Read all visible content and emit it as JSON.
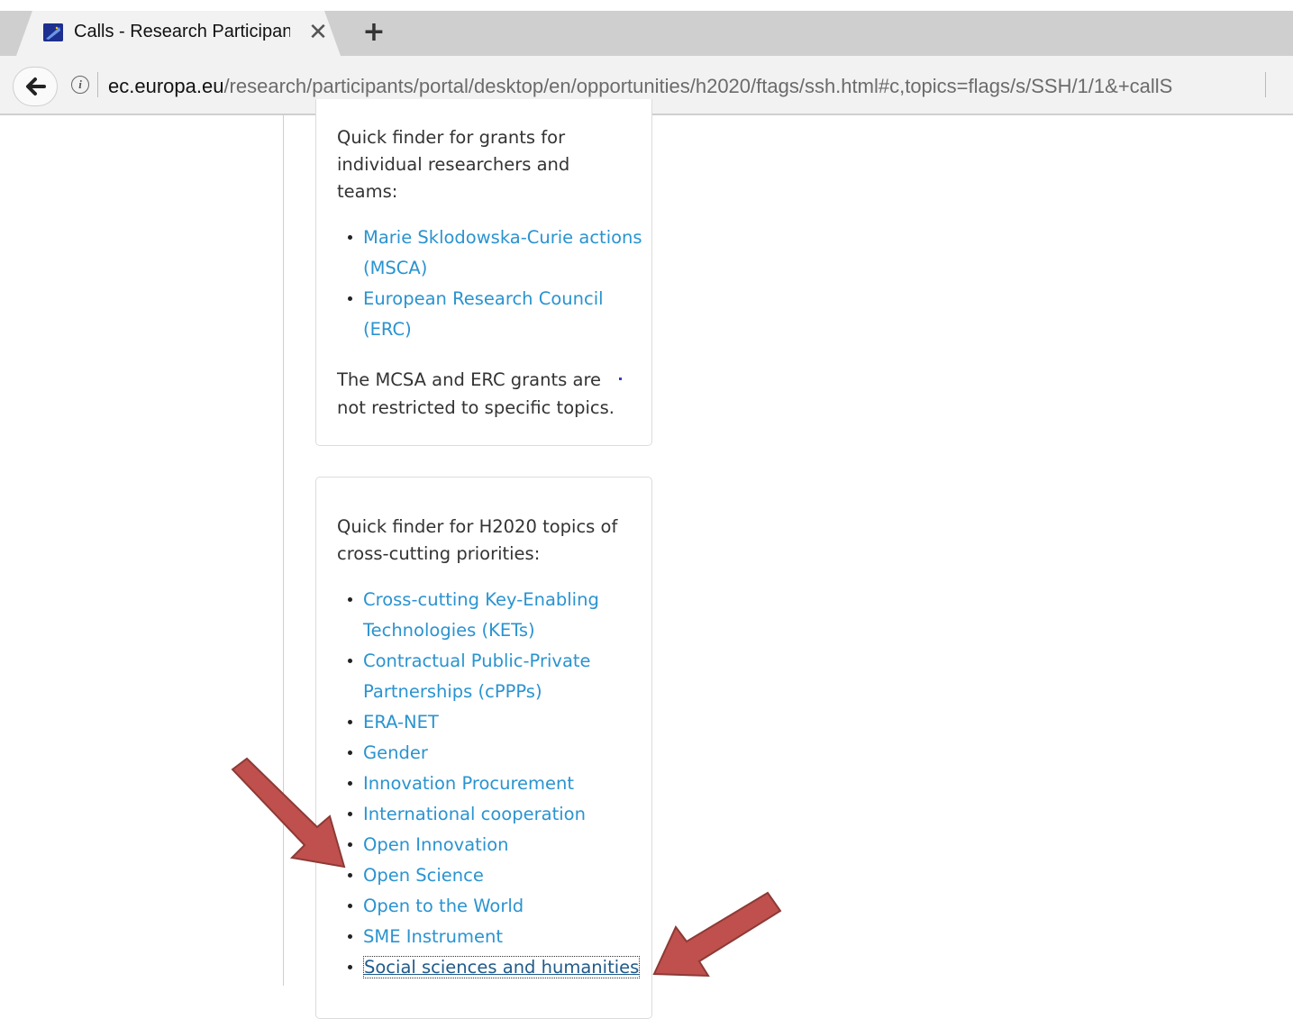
{
  "browser": {
    "tab_title": "Calls - Research Participant Portal",
    "tab_close_glyph": "✕",
    "new_tab_glyph": "+",
    "url_host": "ec.europa.eu",
    "url_path": "/research/participants/portal/desktop/en/opportunities/h2020/ftags/ssh.html#c,topics=flags/s/SSH/1/1&+callS"
  },
  "card_individual": {
    "intro": "Quick finder for grants for individual researchers and teams:",
    "links": [
      "Marie Sklodowska-Curie actions (MSCA)",
      "European Research Council (ERC)"
    ],
    "note": "The MCSA and ERC grants are not restricted to specific topics."
  },
  "card_crosscutting": {
    "intro": "Quick finder for H2020 topics of cross-cutting priorities:",
    "links": [
      "Cross-cutting Key-Enabling Technologies (KETs)",
      "Contractual Public-Private Partnerships (cPPPs)",
      "ERA-NET",
      "Gender",
      "Innovation Procurement",
      "International cooperation",
      "Open Innovation",
      "Open Science",
      "Open to the World",
      "SME Instrument",
      "Social sciences and humanities"
    ]
  },
  "colors": {
    "link": "#2a93d0",
    "text": "#333333",
    "annotation_arrow": "#c0504d"
  },
  "icons": {
    "back": "back-arrow-icon",
    "info": "info-icon",
    "favicon": "eu-flag-icon",
    "annotation": "red-arrow-icon"
  }
}
